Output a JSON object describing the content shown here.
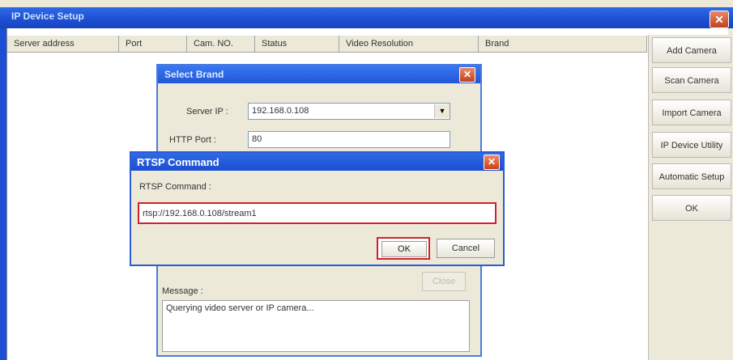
{
  "main_window": {
    "title": "IP Device Setup",
    "close_glyph": "✕",
    "table": {
      "columns": [
        "Server address",
        "Port",
        "Cam. NO.",
        "Status",
        "Video Resolution",
        "Brand"
      ]
    },
    "side_buttons": [
      "Add Camera",
      "Scan Camera",
      "Import Camera",
      "IP Device Utility",
      "Automatic Setup",
      "OK"
    ]
  },
  "select_brand_dialog": {
    "title": "Select Brand",
    "close_glyph": "✕",
    "server_ip_label": "Server IP :",
    "server_ip_value": "192.168.0.108",
    "http_port_label": "HTTP Port :",
    "http_port_value": "80",
    "close_button": "Close",
    "message_label": "Message :",
    "message_text": "Querying video server or IP camera..."
  },
  "rtsp_dialog": {
    "title": "RTSP Command",
    "close_glyph": "✕",
    "label": "RTSP Command :",
    "input_value": "rtsp://192.168.0.108/stream1",
    "ok_button": "OK",
    "cancel_button": "Cancel"
  },
  "colors": {
    "xp_title_blue": "#1c4fd4",
    "highlight_red": "#d4202a",
    "dialog_bg": "#ece9d8"
  },
  "icons": {
    "dropdown": "chevron-down-icon",
    "close": "close-icon"
  }
}
